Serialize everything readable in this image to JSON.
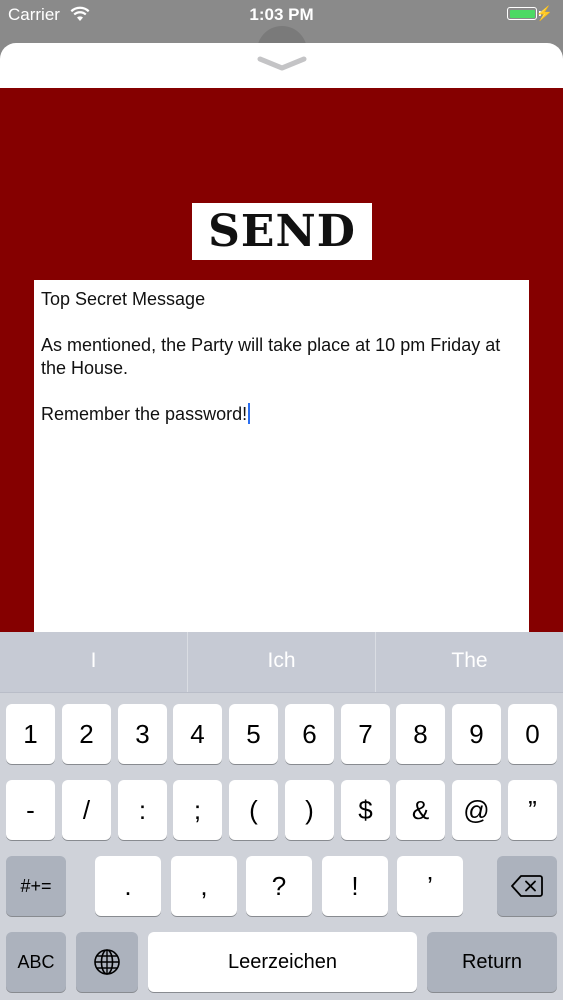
{
  "status_bar": {
    "carrier": "Carrier",
    "time": "1:03 PM",
    "battery_color": "#4cd964"
  },
  "screen": {
    "background_color": "#850000",
    "send_button_label": "SEND",
    "message_title": "Top Secret Message",
    "message_body": "As mentioned, the Party will take place at 10 pm Friday at the House.",
    "message_closing": "Remember the password!"
  },
  "keyboard": {
    "predictions": [
      "I",
      "Ich",
      "The"
    ],
    "row1": [
      "1",
      "2",
      "3",
      "4",
      "5",
      "6",
      "7",
      "8",
      "9",
      "0"
    ],
    "row2": [
      "-",
      "/",
      ":",
      ";",
      "(",
      ")",
      "$",
      "&",
      "@",
      "”"
    ],
    "row3_mode": "#+=",
    "row3": [
      ".",
      ",",
      "?",
      "!",
      "’"
    ],
    "abc": "ABC",
    "space": "Leerzeichen",
    "return": "Return",
    "icons": [
      "globe-icon",
      "backspace-icon"
    ]
  }
}
